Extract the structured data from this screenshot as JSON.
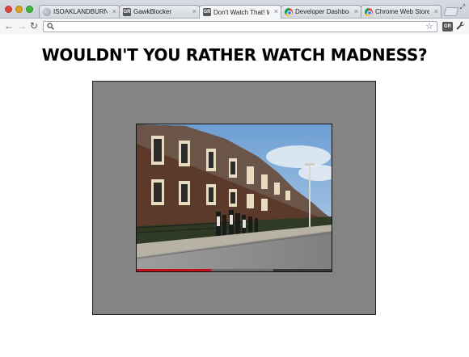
{
  "browser": {
    "tabs": [
      {
        "title": "ISOAKLANDBURNING.C",
        "icon": "globe-icon",
        "active": false
      },
      {
        "title": "GawkBlocker",
        "icon": "gawkblocker-icon",
        "active": false
      },
      {
        "title": "Don't Watch That! Watc",
        "icon": "gawkblocker-icon",
        "active": true
      },
      {
        "title": "Developer Dashboard",
        "icon": "chrome-store-icon",
        "active": false
      },
      {
        "title": "Chrome Web Store - ga",
        "icon": "chrome-store-icon",
        "active": false
      }
    ],
    "ext_badge": "GR",
    "address": ""
  },
  "page": {
    "heading": "WOULDN'T YOU RATHER WATCH MADNESS?"
  },
  "video": {
    "progress": 0.38,
    "buffered": 0.7,
    "progress_color": "#c1121a"
  }
}
